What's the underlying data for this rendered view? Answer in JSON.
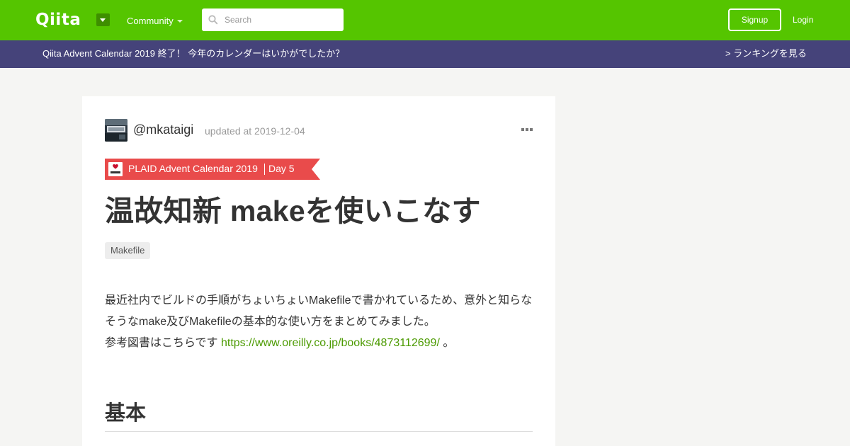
{
  "header": {
    "logo": "Qiita",
    "community_label": "Community",
    "search_placeholder": "Search",
    "signup_label": "Signup",
    "login_label": "Login"
  },
  "banner": {
    "text": "Qiita Advent Calendar 2019 終了！ 今年のカレンダーはいかがでしたか？",
    "link": "> ランキングを見る"
  },
  "article": {
    "author": "@mkataigi",
    "updated": "updated at 2019-12-04",
    "calendar": {
      "title": "PLAID Advent Calendar 2019",
      "day": "Day 5",
      "logo_text": "PLAID"
    },
    "title": "温故知新 makeを使いこなす",
    "tags": [
      "Makefile"
    ],
    "paragraph": {
      "line1": "最近社内でビルドの手順がちょいちょいMakefileで書かれているため、意外と知らな",
      "line2": "そうなmake及びMakefileの基本的な使い方をまとめてみました。",
      "line3_prefix": "参考図書はこちらです ",
      "line3_link": "https://www.oreilly.co.jp/books/4873112699/",
      "line3_suffix": " 。"
    },
    "heading": "基本"
  },
  "colors": {
    "brand": "#55c500",
    "banner": "#45437a",
    "ribbon": "#e94b4b",
    "link": "#4b9a00"
  },
  "icons": [
    "logo-menu-icon",
    "caret-down-icon",
    "search-icon",
    "more-icon",
    "plaid-logo-icon"
  ]
}
